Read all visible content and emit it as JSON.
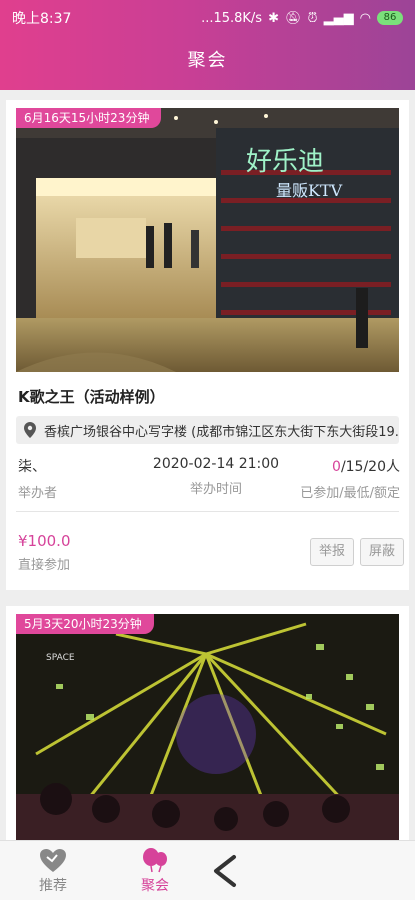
{
  "status_bar": {
    "time": "晚上8:37",
    "network_speed": "...15.8K/s",
    "battery": "86"
  },
  "header": {
    "title": "聚会"
  },
  "events": [
    {
      "countdown": "6月16天15小时23分钟",
      "title": "K歌之王（活动样例）",
      "address": "香槟广场银谷中心写字楼 (成都市锦江区东大街下东大街段19...",
      "organizer": "柒、",
      "organizer_label": "举办者",
      "datetime": "2020-02-14 21:00",
      "datetime_label": "举办时间",
      "joined": "0",
      "capacity": "/15/20人",
      "capacity_label": "已参加/最低/额定",
      "price": "¥100.0",
      "join_mode": "直接参加",
      "report_label": "举报",
      "block_label": "屏蔽",
      "sign_text": "好乐迪",
      "sign_sub": "量贩KTV"
    },
    {
      "countdown": "5月3天20小时23分钟",
      "venue_text": "SPACE"
    }
  ],
  "tabs": [
    {
      "label": "推荐",
      "icon": "heart-icon"
    },
    {
      "label": "聚会",
      "icon": "balloons-icon"
    }
  ],
  "colors": {
    "accent": "#d6439a",
    "header_start": "#e03f8e",
    "header_end": "#9c4497"
  }
}
